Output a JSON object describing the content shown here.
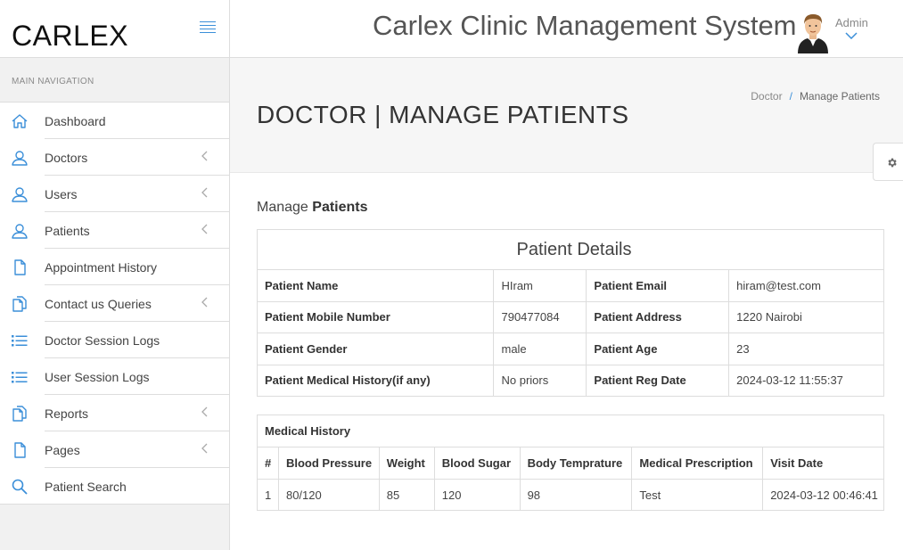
{
  "brand": "CARLEX",
  "app_title": "Carlex Clinic Management System",
  "user": {
    "name": "Admin"
  },
  "nav_heading": "MAIN NAVIGATION",
  "nav": [
    {
      "label": "Dashboard",
      "icon": "home-icon",
      "has_submenu": false
    },
    {
      "label": "Doctors",
      "icon": "user-icon",
      "has_submenu": true
    },
    {
      "label": "Users",
      "icon": "user-icon",
      "has_submenu": true
    },
    {
      "label": "Patients",
      "icon": "user-icon",
      "has_submenu": true
    },
    {
      "label": "Appointment History",
      "icon": "file-icon",
      "has_submenu": false
    },
    {
      "label": "Contact us Queries",
      "icon": "files-icon",
      "has_submenu": true
    },
    {
      "label": "Doctor Session Logs",
      "icon": "list-icon",
      "has_submenu": false
    },
    {
      "label": "User Session Logs",
      "icon": "list-icon",
      "has_submenu": false
    },
    {
      "label": "Reports",
      "icon": "files-icon",
      "has_submenu": true
    },
    {
      "label": "Pages",
      "icon": "file-icon",
      "has_submenu": true
    },
    {
      "label": "Patient Search",
      "icon": "search-icon",
      "has_submenu": false
    }
  ],
  "page": {
    "title": "DOCTOR | MANAGE PATIENTS",
    "breadcrumb": [
      "Doctor",
      "Manage Patients"
    ],
    "heading_prefix": "Manage",
    "heading_strong": "Patients"
  },
  "patient_details": {
    "caption": "Patient Details",
    "rows": [
      {
        "k1": "Patient Name",
        "v1": "HIram",
        "k2": "Patient Email",
        "v2": "hiram@test.com"
      },
      {
        "k1": "Patient Mobile Number",
        "v1": "790477084",
        "k2": "Patient Address",
        "v2": "1220 Nairobi"
      },
      {
        "k1": "Patient Gender",
        "v1": "male",
        "k2": "Patient Age",
        "v2": "23"
      },
      {
        "k1": "Patient Medical History(if any)",
        "v1": "No priors",
        "k2": "Patient Reg Date",
        "v2": "2024-03-12 11:55:37"
      }
    ]
  },
  "medical_history": {
    "caption": "Medical History",
    "columns": [
      "#",
      "Blood Pressure",
      "Weight",
      "Blood Sugar",
      "Body Temprature",
      "Medical Prescription",
      "Visit Date"
    ],
    "rows": [
      [
        "1",
        "80/120",
        "85",
        "120",
        "98",
        "Test",
        "2024-03-12 00:46:41"
      ]
    ]
  },
  "colors": {
    "accent": "#3b8fd9"
  }
}
